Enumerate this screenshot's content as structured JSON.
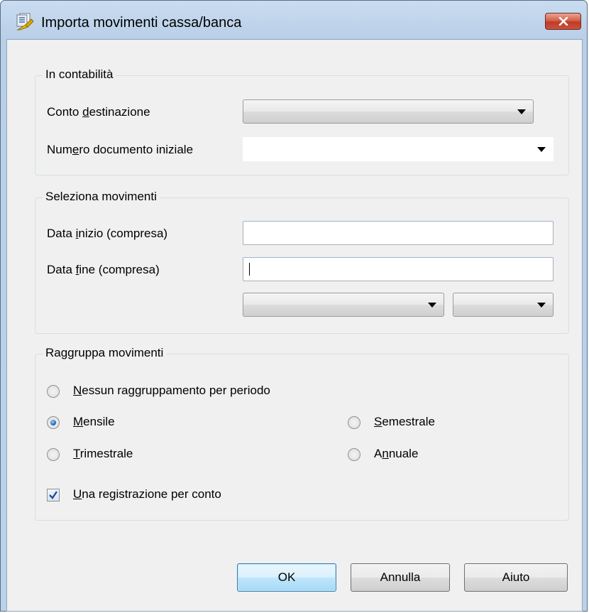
{
  "window": {
    "title": "Importa movimenti cassa/banca",
    "close_symbol": "✕"
  },
  "group_contabilita": {
    "legend": "In contabilità",
    "conto_label_pre": "Conto ",
    "conto_label_key": "d",
    "conto_label_post": "estinazione",
    "numero_label_pre": "Num",
    "numero_label_key": "e",
    "numero_label_post": "ro documento iniziale",
    "conto_value": "",
    "numero_value": ""
  },
  "group_seleziona": {
    "legend": "Seleziona movimenti",
    "data_inizio_pre": "Data ",
    "data_inizio_key": "i",
    "data_inizio_post": "nizio (compresa)",
    "data_fine_pre": "Data ",
    "data_fine_key": "f",
    "data_fine_post": "ine (compresa)",
    "data_inizio_value": "",
    "data_fine_value": "",
    "period_combo_value": "",
    "year_combo_value": ""
  },
  "group_raggruppa": {
    "legend": "Raggruppa movimenti",
    "options": [
      {
        "key": "N",
        "rest": "essun raggruppamento per periodo",
        "checked": false
      },
      {
        "key": "M",
        "rest": "ensile",
        "checked": true
      },
      {
        "key": "S",
        "rest": "emestrale",
        "checked": false
      },
      {
        "key": "T",
        "rest": "rimestrale",
        "checked": false
      },
      {
        "pre": "A",
        "key": "n",
        "rest": "nuale",
        "checked": false
      }
    ],
    "checkbox": {
      "key": "U",
      "rest": "na registrazione per conto",
      "checked": true
    }
  },
  "buttons": {
    "ok": "OK",
    "annulla": "Annulla",
    "aiuto": "Aiuto"
  }
}
